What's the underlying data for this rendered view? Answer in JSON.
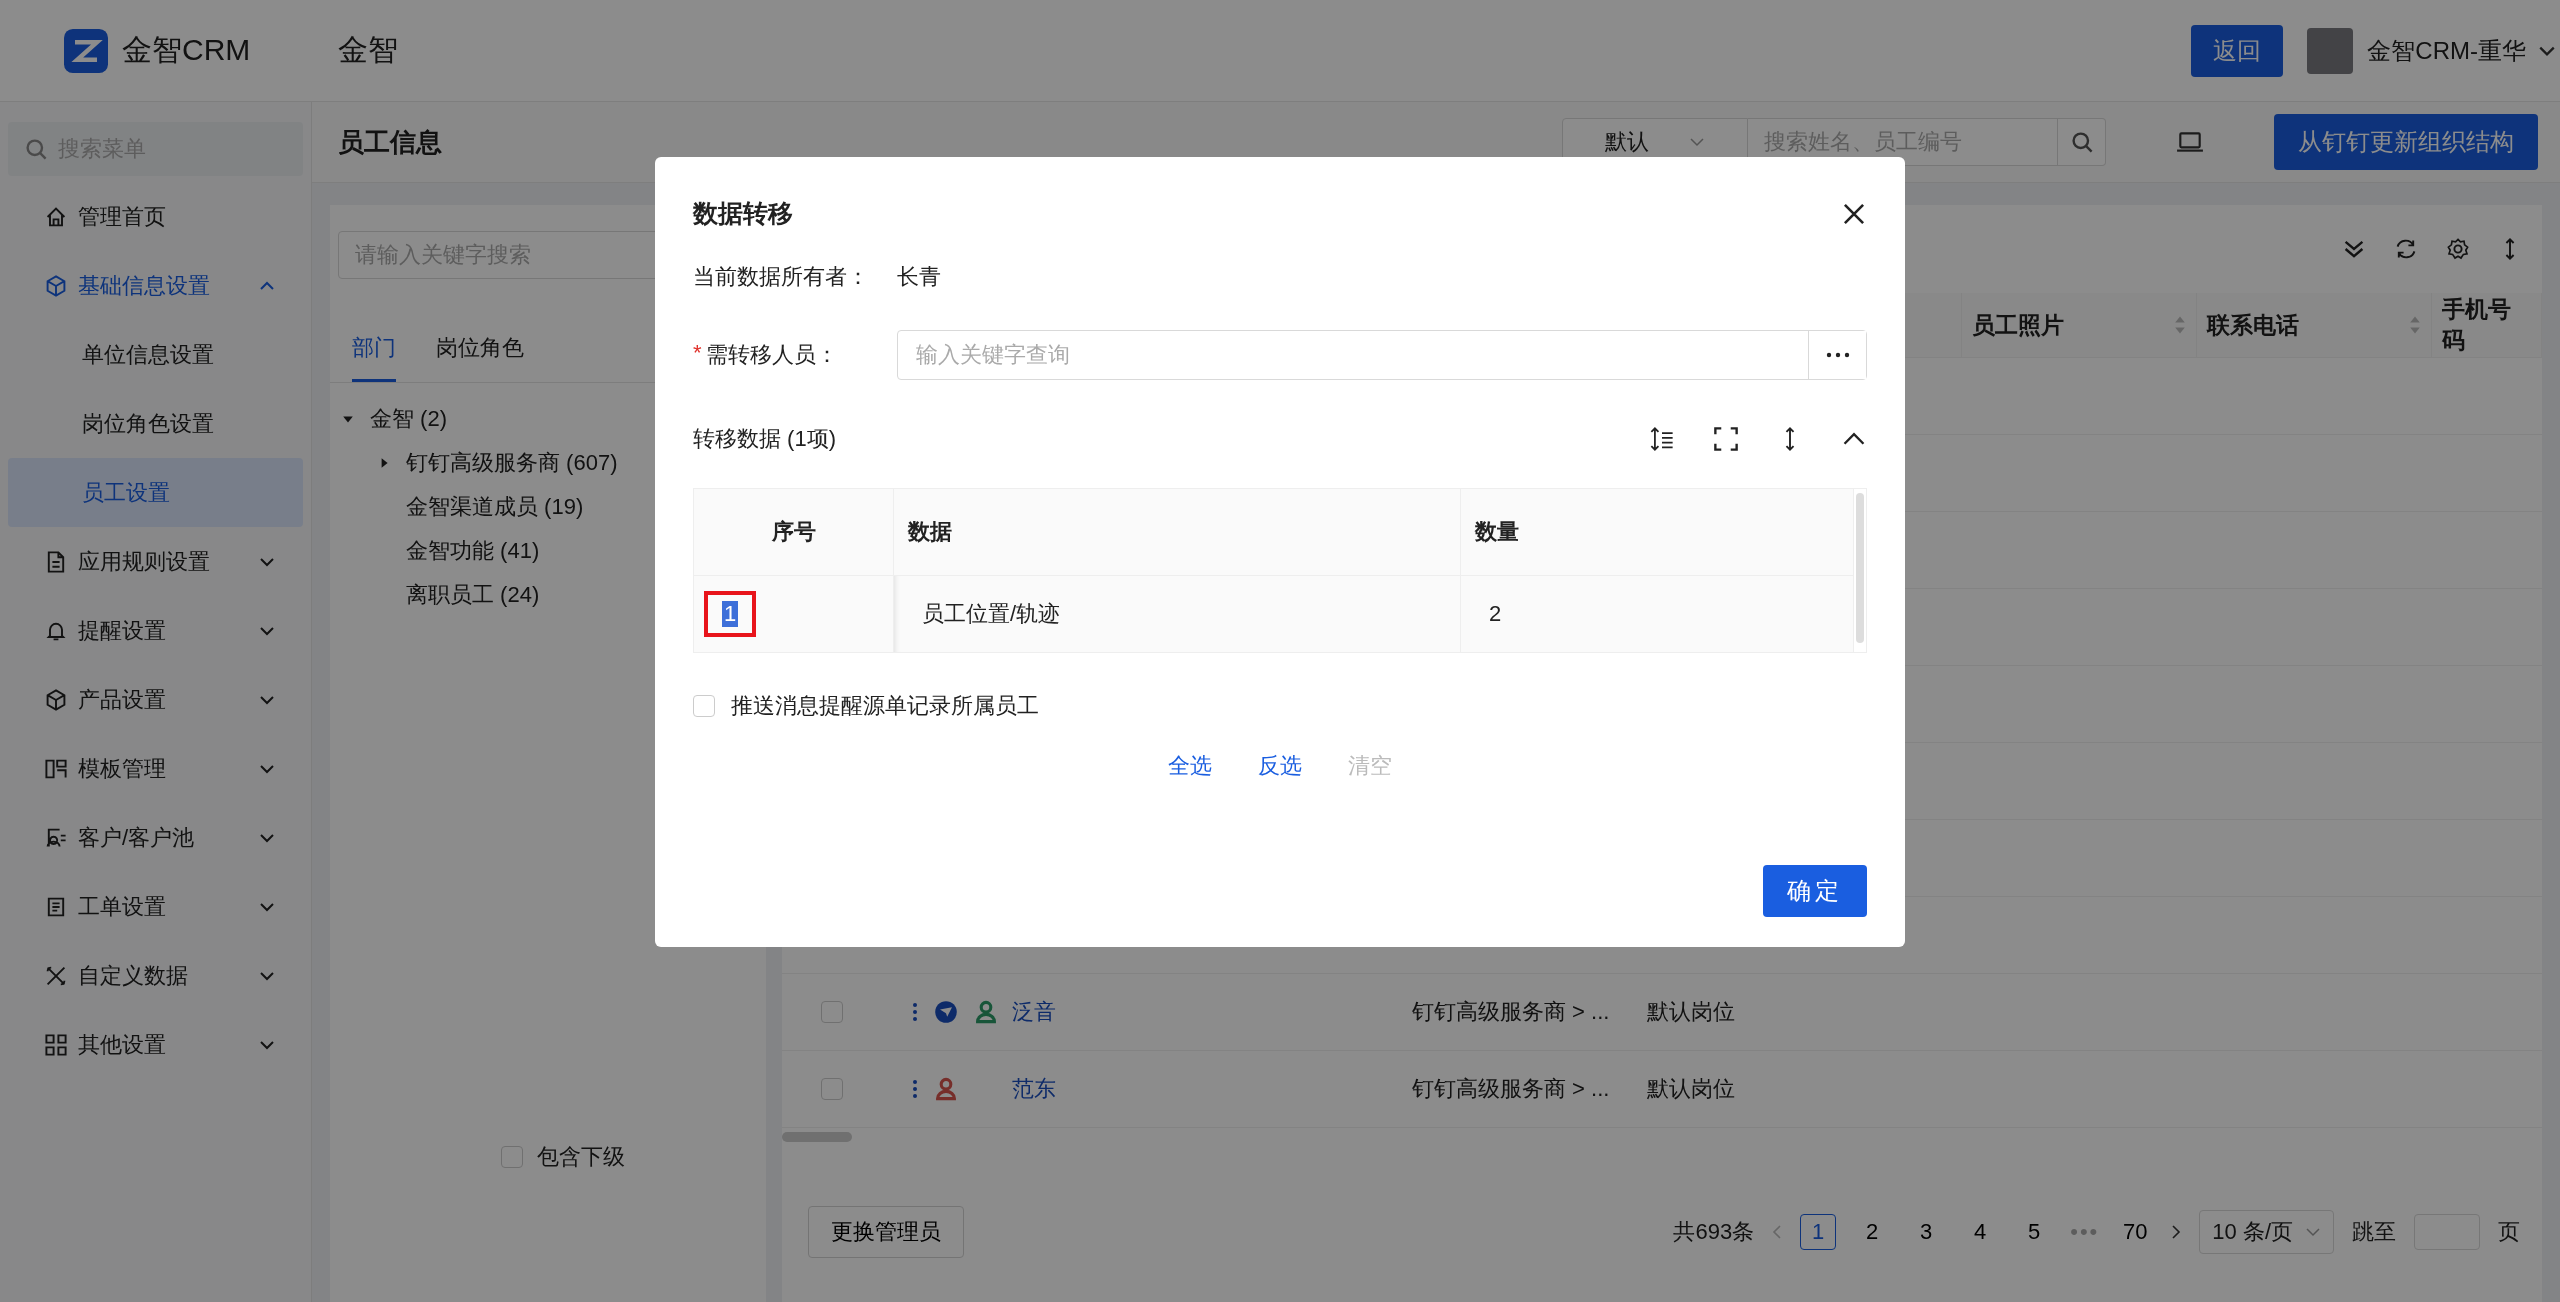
{
  "topbar": {
    "logo_text": "金智CRM",
    "org": "金智",
    "back_button": "返回",
    "user": "金智CRM-重华"
  },
  "sidebar": {
    "search_placeholder": "搜索菜单",
    "items": [
      {
        "label": "管理首页",
        "selected": false
      },
      {
        "label": "基础信息设置",
        "selected": false,
        "expanded": true,
        "children": [
          {
            "label": "单位信息设置",
            "selected": false
          },
          {
            "label": "岗位角色设置",
            "selected": false
          },
          {
            "label": "员工设置",
            "selected": true
          }
        ]
      },
      {
        "label": "应用规则设置",
        "selected": false,
        "expanded": false
      },
      {
        "label": "提醒设置",
        "selected": false,
        "expanded": false
      },
      {
        "label": "产品设置",
        "selected": false,
        "expanded": false
      },
      {
        "label": "模板管理",
        "selected": false,
        "expanded": false
      },
      {
        "label": "客户/客户池",
        "selected": false,
        "expanded": false
      },
      {
        "label": "工单设置",
        "selected": false,
        "expanded": false
      },
      {
        "label": "自定义数据",
        "selected": false,
        "expanded": false
      },
      {
        "label": "其他设置",
        "selected": false,
        "expanded": false
      }
    ]
  },
  "page": {
    "title": "员工信息",
    "view_select": "默认",
    "search_placeholder": "搜索姓名、员工编号",
    "sync_button": "从钉钉更新组织结构"
  },
  "dept_panel": {
    "search_placeholder": "请输入关键字搜索",
    "tabs": [
      {
        "label": "部门",
        "selected": true
      },
      {
        "label": "岗位角色",
        "selected": false
      }
    ],
    "tree": [
      {
        "label": "金智 (2)",
        "expanded": true,
        "children": [
          {
            "label": "钉钉高级服务商 (607)",
            "expanded": false
          },
          {
            "label": "金智渠道成员 (19)"
          },
          {
            "label": "金智功能 (41)"
          },
          {
            "label": "离职员工 (24)"
          }
        ]
      }
    ],
    "include_sub": {
      "label": "包含下级",
      "checked": false
    }
  },
  "table": {
    "columns": [
      "员工照片",
      "联系电话",
      "手机号码"
    ],
    "rows": [
      {
        "checked": false,
        "has_badge": true,
        "color": "#19563a",
        "name": "泛音",
        "dept": "钉钉高级服务商 > ...",
        "position": "默认岗位"
      },
      {
        "checked": false,
        "has_badge": false,
        "color": "#772e2b",
        "name": "范东",
        "dept": "钉钉高级服务商 > ...",
        "position": "默认岗位"
      }
    ]
  },
  "footer": {
    "admin_button": "更换管理员",
    "total": "共693条",
    "pages": [
      {
        "label": "1",
        "selected": true
      },
      {
        "label": "2",
        "selected": false
      },
      {
        "label": "3",
        "selected": false
      },
      {
        "label": "4",
        "selected": false
      },
      {
        "label": "5",
        "selected": false
      },
      {
        "label": "•••",
        "kind": "ellipsis"
      },
      {
        "label": "70",
        "selected": false
      }
    ],
    "page_size": "10 条/页",
    "jump_label": "跳至",
    "page_suffix": "页"
  },
  "dialog": {
    "title": "数据转移",
    "owner_label": "当前数据所有者：",
    "owner": "长青",
    "transfer_label": "需转移人员：",
    "required_mark": "*",
    "transfer_placeholder": "输入关键字查询",
    "section_title": "转移数据 (1项)",
    "table": {
      "columns": [
        "序号",
        "数据",
        "数量"
      ],
      "rows": [
        {
          "index": "1",
          "data": "员工位置/轨迹",
          "count": "2",
          "highlighted": true
        }
      ]
    },
    "notify": {
      "label": "推送消息提醒源单记录所属员工",
      "checked": false
    },
    "actions": [
      {
        "label": "全选",
        "disabled": false
      },
      {
        "label": "反选",
        "disabled": false
      },
      {
        "label": "清空",
        "disabled": true
      }
    ],
    "confirm": "确定"
  }
}
